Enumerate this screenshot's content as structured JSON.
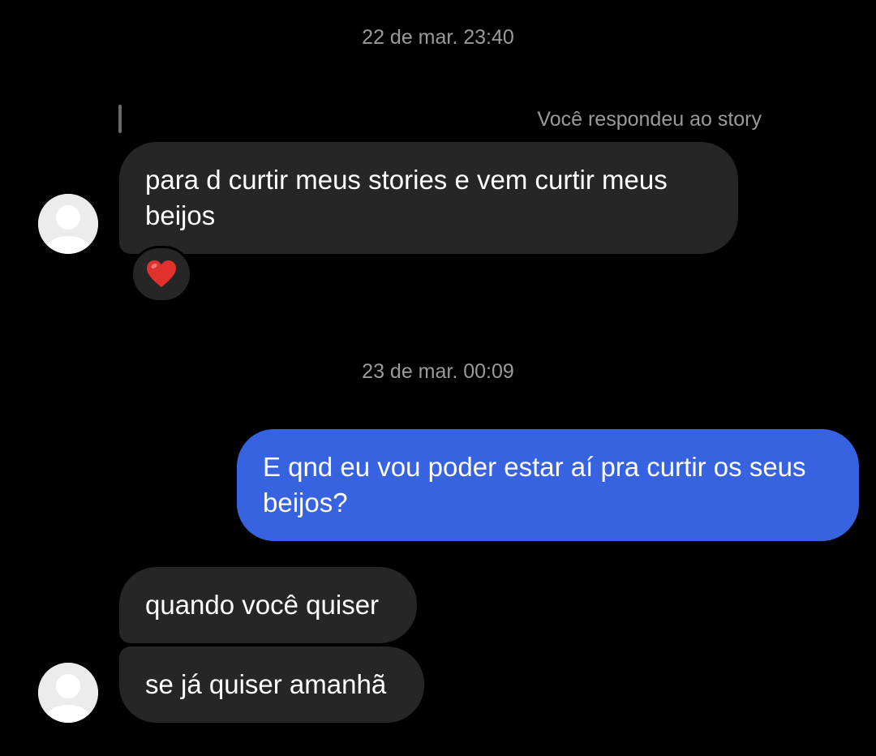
{
  "conversation": {
    "timestamps": {
      "first": "22 de mar. 23:40",
      "second": "23 de mar. 00:09"
    },
    "story_reply": {
      "label": "Você respondeu ao story"
    },
    "messages": [
      {
        "sender": "contact",
        "text": "para d curtir meus stories e vem curtir meus beijos",
        "reaction": "heart-icon"
      },
      {
        "sender": "me",
        "text": "E qnd eu vou poder estar aí pra curtir os seus beijos?"
      },
      {
        "sender": "contact",
        "text": "quando você quiser"
      },
      {
        "sender": "contact",
        "text": "se já quiser amanhã"
      }
    ]
  },
  "colors": {
    "background": "#000000",
    "incoming_bubble": "#262626",
    "outgoing_bubble": "#3863e0",
    "muted_text": "#9a9a9a",
    "heart": "#e0312d"
  }
}
